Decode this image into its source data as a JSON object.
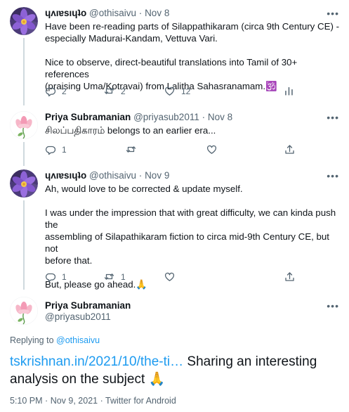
{
  "tweets": [
    {
      "name": "ɥʌıɐsıɥʇo",
      "handle": "@othisaivu",
      "date": "Nov 8",
      "lines": [
        "Have been re-reading parts of Silappathikaram (circa 9th Century CE) -",
        "especially Madurai-Kandam, Vettuva Vari.",
        "",
        "Nice to observe, direct-beautiful translations into Tamil of 30+ references",
        "(praising Uma/Kotravai) from Lalitha Sahasranamam.🕉️"
      ],
      "replies": "2",
      "retweets": "2",
      "likes": "12"
    },
    {
      "name": "Priya Subramanian",
      "handle": "@priyasub2011",
      "date": "Nov 8",
      "lines": [
        "சிலப்பதிகாரம்  belongs to an earlier era..."
      ],
      "replies": "1",
      "retweets": "",
      "likes": ""
    },
    {
      "name": "ɥʌıɐsıɥʇo",
      "handle": "@othisaivu",
      "date": "Nov 9",
      "lines": [
        "Ah, would love to be corrected & update myself.",
        "",
        "I was under the impression that with great difficulty, we can kinda push the",
        "assembling of Silapathikaram fiction to circa mid-9th Century CE, but not",
        "before that.",
        "",
        "But, please go ahead.🙏"
      ],
      "replies": "1",
      "retweets": "1",
      "likes": ""
    }
  ],
  "main_tweet": {
    "name": "Priya Subramanian",
    "handle": "@priyasub2011",
    "replying_label": "Replying to",
    "replying_to": "@othisaivu",
    "link_text": "tskrishnan.in/2021/10/the-ti…",
    "text_line1": " Sharing an interesting",
    "text_line2": "analysis on the subject 🙏",
    "time": "5:10 PM",
    "date": "Nov 9, 2021",
    "source": "Twitter for Android"
  },
  "separators": {
    "dot": "·",
    "more": "•••"
  },
  "icons": {
    "reply": "reply-icon",
    "retweet": "retweet-icon",
    "like": "like-icon",
    "share": "share-icon",
    "analytics": "analytics-icon",
    "more": "more-icon"
  },
  "colors": {
    "accent": "#1d9bf0",
    "secondary_text": "#536471",
    "thread_line": "#cfd9de"
  }
}
